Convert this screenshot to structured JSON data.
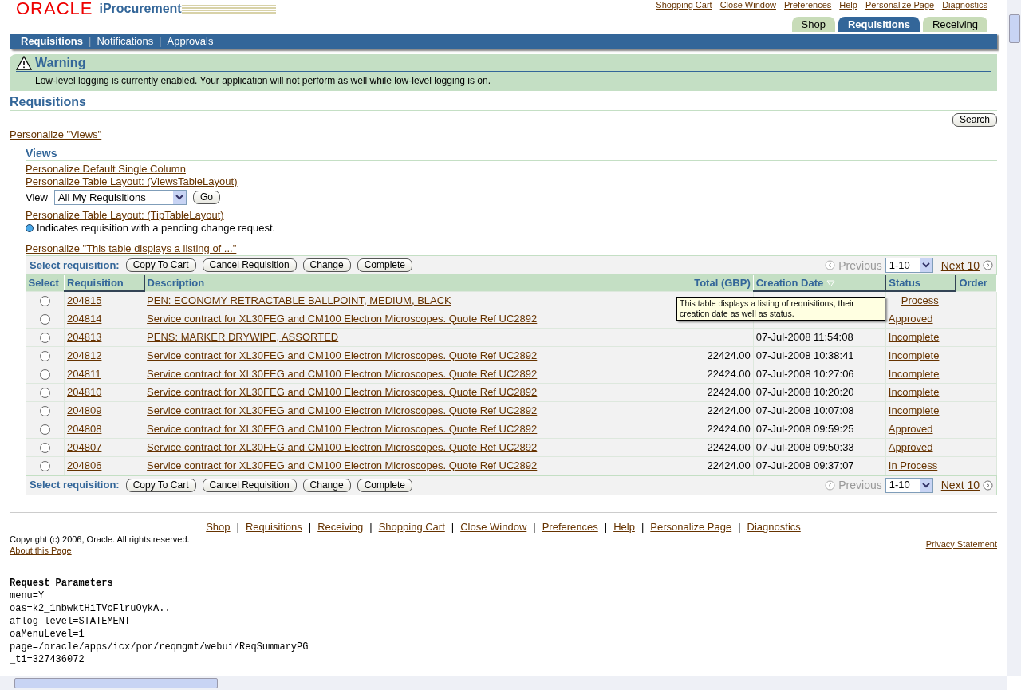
{
  "header": {
    "brand": "ORACLE",
    "product": "iProcurement",
    "global_links": [
      "Shopping Cart",
      "Close Window",
      "Preferences",
      "Help",
      "Personalize Page",
      "Diagnostics"
    ]
  },
  "tabs": [
    {
      "label": "Shop",
      "selected": false
    },
    {
      "label": "Requisitions",
      "selected": true
    },
    {
      "label": "Receiving",
      "selected": false
    }
  ],
  "subnav": [
    {
      "kind": "link",
      "label": "Requisitions",
      "selected": true
    },
    {
      "kind": "separator",
      "label": "|"
    },
    {
      "kind": "link",
      "label": "Notifications",
      "selected": false
    },
    {
      "kind": "separator",
      "label": "|"
    },
    {
      "kind": "link",
      "label": "Approvals",
      "selected": false
    }
  ],
  "warning": {
    "title": "Warning",
    "message": "Low-level logging is currently enabled. Your application will not perform as well while low-level logging is on."
  },
  "page_title": "Requisitions",
  "search_button": "Search",
  "personalize_views": "Personalize \"Views\"",
  "views": {
    "title": "Views",
    "links": [
      "Personalize Default Single Column",
      "Personalize Table Layout: (ViewsTableLayout)"
    ],
    "view_label": "View",
    "view_value": "All My Requisitions",
    "go": "Go",
    "tip_link": "Personalize Table Layout: (TipTableLayout)",
    "tip": "Indicates requisition with a pending change request."
  },
  "table_personalize": "Personalize \"This table displays a listing of ...\"",
  "top_actions": {
    "label": "Select requisition:",
    "buttons": [
      "Copy To Cart",
      "Cancel Requisition",
      "Change",
      "Complete"
    ],
    "previous": "Previous",
    "range": "1-10",
    "next": "Next 10"
  },
  "table": {
    "columns": [
      "Select",
      "Requisition",
      "Description",
      "Total (GBP)",
      "Creation Date",
      "Status",
      "Order"
    ],
    "rows": [
      {
        "selected": false,
        "requisition": "204815",
        "description": "PEN: ECONOMY RETRACTABLE BALLPOINT, MEDIUM, BLACK",
        "status": "Process"
      },
      {
        "selected": false,
        "requisition": "204814",
        "description": "Service contract for XL30FEG and CM100 Electron Microscopes. Quote Ref UC2892",
        "status": "Approved"
      },
      {
        "selected": false,
        "requisition": "204813",
        "description": "PENS: MARKER DRYWIPE, ASSORTED",
        "date": "07-Jul-2008 11:54:08",
        "status": "Incomplete"
      },
      {
        "selected": false,
        "requisition": "204812",
        "description": "Service contract for XL30FEG and CM100 Electron Microscopes. Quote Ref UC2892",
        "total": "22424.00",
        "date": "07-Jul-2008 10:38:41",
        "status": "Incomplete"
      },
      {
        "selected": false,
        "requisition": "204811",
        "description": "Service contract for XL30FEG and CM100 Electron Microscopes. Quote Ref UC2892",
        "total": "22424.00",
        "date": "07-Jul-2008 10:27:06",
        "status": "Incomplete"
      },
      {
        "selected": false,
        "requisition": "204810",
        "description": "Service contract for XL30FEG and CM100 Electron Microscopes. Quote Ref UC2892",
        "total": "22424.00",
        "date": "07-Jul-2008 10:20:20",
        "status": "Incomplete"
      },
      {
        "selected": false,
        "requisition": "204809",
        "description": "Service contract for XL30FEG and CM100 Electron Microscopes. Quote Ref UC2892",
        "total": "22424.00",
        "date": "07-Jul-2008 10:07:08",
        "status": "Incomplete"
      },
      {
        "selected": false,
        "requisition": "204808",
        "description": "Service contract for XL30FEG and CM100 Electron Microscopes. Quote Ref UC2892",
        "total": "22424.00",
        "date": "07-Jul-2008 09:59:25",
        "status": "Approved"
      },
      {
        "selected": false,
        "requisition": "204807",
        "description": "Service contract for XL30FEG and CM100 Electron Microscopes. Quote Ref UC2892",
        "total": "22424.00",
        "date": "07-Jul-2008 09:50:33",
        "status": "Approved"
      },
      {
        "selected": false,
        "requisition": "204806",
        "description": "Service contract for XL30FEG and CM100 Electron Microscopes. Quote Ref UC2892",
        "total": "22424.00",
        "date": "07-Jul-2008 09:37:07",
        "status": "In Process"
      }
    ]
  },
  "tooltip": "This table displays a listing of  requisitions, their creation date as well as status.",
  "bottom_actions": {
    "label": "Select requisition:",
    "buttons": [
      "Copy To Cart",
      "Cancel Requisition",
      "Change",
      "Complete"
    ],
    "previous": "Previous",
    "range": "1-10",
    "next": "Next 10"
  },
  "footer": {
    "items": [
      {
        "kind": "link",
        "label": "Shop"
      },
      {
        "kind": "separator",
        "label": "|"
      },
      {
        "kind": "link",
        "label": "Requisitions"
      },
      {
        "kind": "separator",
        "label": "|"
      },
      {
        "kind": "link",
        "label": "Receiving"
      },
      {
        "kind": "separator",
        "label": "|"
      },
      {
        "kind": "link",
        "label": "Shopping Cart"
      },
      {
        "kind": "separator",
        "label": "|"
      },
      {
        "kind": "link",
        "label": "Close Window"
      },
      {
        "kind": "separator",
        "label": "|"
      },
      {
        "kind": "link",
        "label": "Preferences"
      },
      {
        "kind": "separator",
        "label": "|"
      },
      {
        "kind": "link",
        "label": "Help"
      },
      {
        "kind": "separator",
        "label": "|"
      },
      {
        "kind": "link",
        "label": "Personalize Page"
      },
      {
        "kind": "separator",
        "label": "|"
      },
      {
        "kind": "link",
        "label": "Diagnostics"
      }
    ],
    "copyright": "Copyright (c) 2006, Oracle. All rights reserved.",
    "about": "About this Page",
    "privacy": "Privacy Statement"
  },
  "request_parameters": {
    "title": "Request Parameters",
    "lines": [
      "menu=Y",
      "oas=k2_1nbwktHiTVcFlruOykA..",
      "aflog_level=STATEMENT",
      "oaMenuLevel=1",
      "page=/oracle/apps/icx/por/reqmgmt/webui/ReqSummaryPG",
      "_ti=327436072"
    ]
  }
}
